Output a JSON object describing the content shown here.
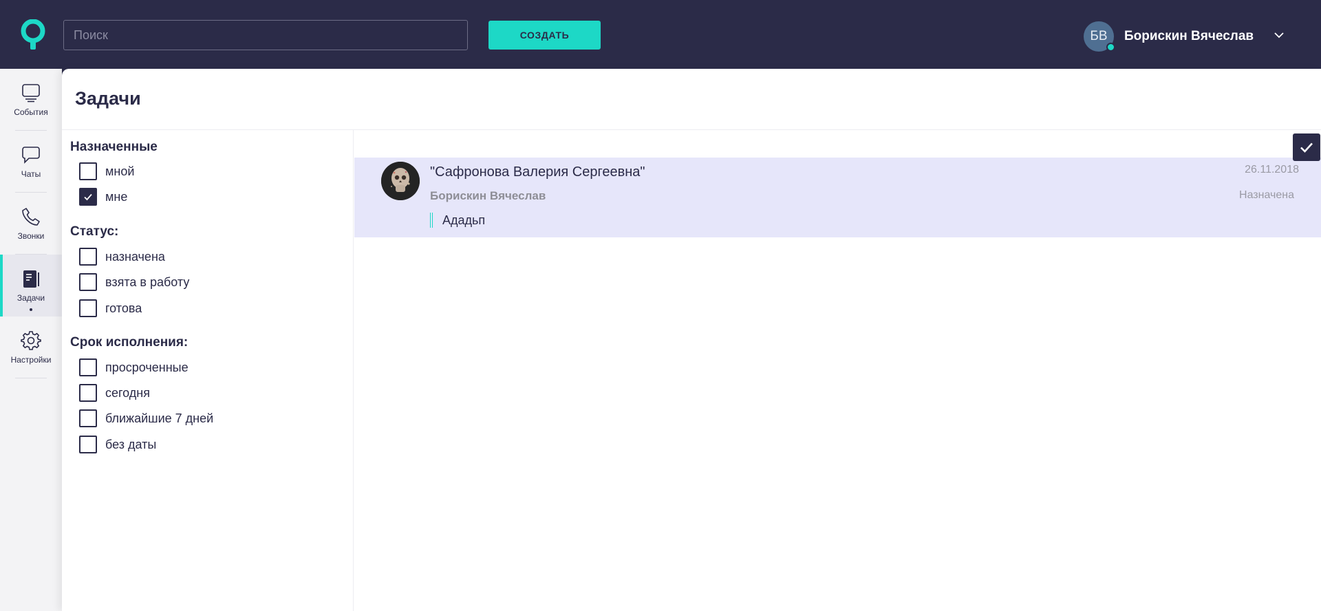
{
  "header": {
    "search_placeholder": "Поиск",
    "create_label": "СОЗДАТЬ",
    "user_initials": "БВ",
    "user_name": "Борискин Вячеслав"
  },
  "sidebar": {
    "items": [
      {
        "label": "События",
        "icon": "monitor-icon"
      },
      {
        "label": "Чаты",
        "icon": "chat-bubble-icon"
      },
      {
        "label": "Звонки",
        "icon": "phone-icon"
      },
      {
        "label": "Задачи",
        "icon": "task-list-icon",
        "active": true
      },
      {
        "label": "Настройки",
        "icon": "gear-icon"
      }
    ]
  },
  "page": {
    "title": "Задачи"
  },
  "filters": {
    "assigned": {
      "title": "Назначенные",
      "options": [
        {
          "label": "мной",
          "checked": false
        },
        {
          "label": "мне",
          "checked": true
        }
      ]
    },
    "status": {
      "title": "Статус:",
      "options": [
        {
          "label": "назначена",
          "checked": false
        },
        {
          "label": "взята в работу",
          "checked": false
        },
        {
          "label": "готова",
          "checked": false
        }
      ]
    },
    "deadline": {
      "title": "Срок исполнения:",
      "options": [
        {
          "label": "просроченные",
          "checked": false
        },
        {
          "label": "сегодня",
          "checked": false
        },
        {
          "label": "ближайшие 7 дней",
          "checked": false
        },
        {
          "label": "без даты",
          "checked": false
        }
      ]
    }
  },
  "tasks": [
    {
      "title": "\"Сафронова Валерия Сергеевна\"",
      "author": "Борискин Вячеслав",
      "body": "Ададьп",
      "date": "26.11.2018",
      "status": "Назначена"
    }
  ],
  "colors": {
    "accent": "#1dd8c6",
    "dark": "#2b2b48",
    "task_highlight": "#e6e6fa"
  }
}
